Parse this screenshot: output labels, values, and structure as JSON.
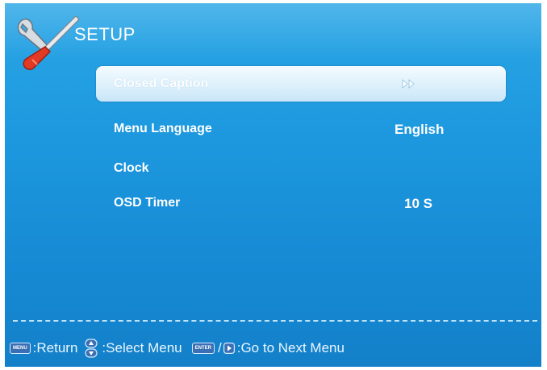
{
  "header": {
    "title": "SETUP",
    "icon": "tools-icon"
  },
  "menu": {
    "items": [
      {
        "label": "Closed Caption",
        "value": "",
        "icon": "double-right-arrow-icon",
        "selected": true
      },
      {
        "label": "Menu Language",
        "value": "English",
        "selected": false
      },
      {
        "label": "Clock",
        "value": "",
        "selected": false
      },
      {
        "label": "OSD Timer",
        "value": "10 S",
        "selected": false
      }
    ]
  },
  "footer": {
    "menu_key": "MENU",
    "return_label": ":Return",
    "select_label": ":Select Menu",
    "enter_key": "ENTER",
    "slash": "/",
    "next_label": ":Go to Next Menu"
  },
  "colors": {
    "background": "#1c97de",
    "highlight": "#ddf0fb",
    "text": "#ffffff"
  }
}
